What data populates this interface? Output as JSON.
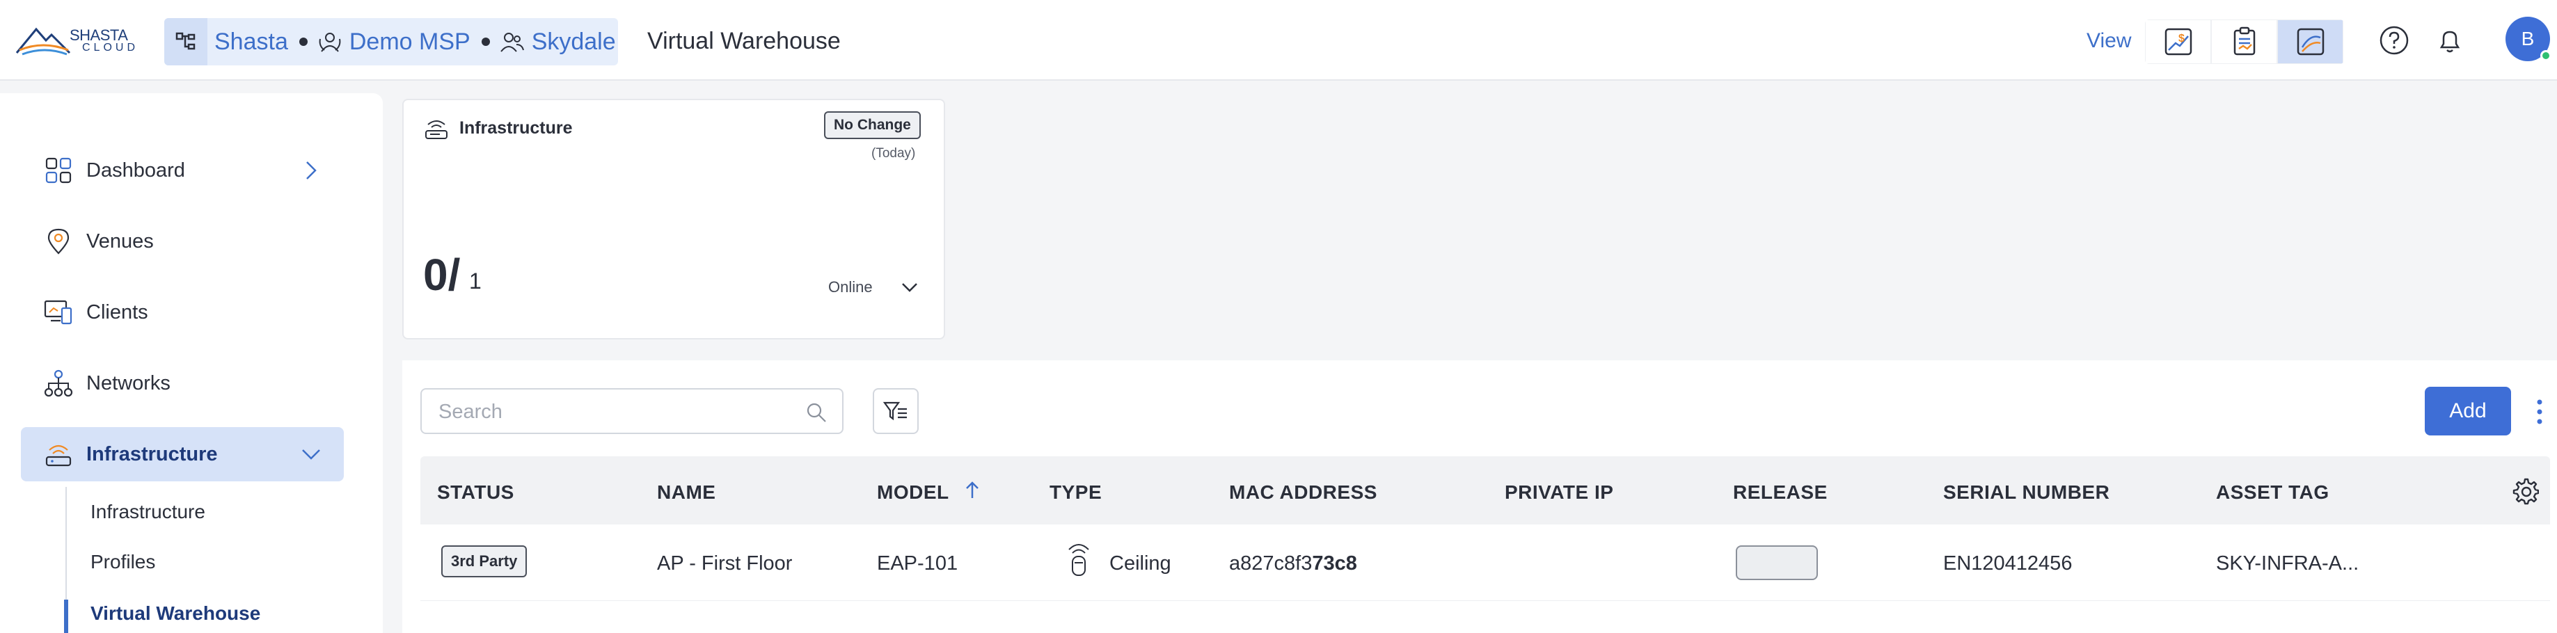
{
  "brand": {
    "line1": "SHASTA",
    "line2": "CLOUD"
  },
  "breadcrumb": [
    {
      "label": "Shasta",
      "icon": "org-chart-icon"
    },
    {
      "label": "Demo MSP",
      "icon": "msp-icon"
    },
    {
      "label": "Skydale",
      "icon": "users-icon"
    }
  ],
  "page_title": "Virtual Warehouse",
  "view": {
    "label": "View",
    "buttons": [
      "billing-view-icon",
      "report-view-icon",
      "network-view-icon"
    ],
    "active_index": 2
  },
  "user": {
    "initial": "B",
    "status_color": "#2fbf71"
  },
  "sidebar": {
    "items": [
      {
        "label": "Dashboard",
        "icon": "dashboard-icon",
        "has_chevron": "right"
      },
      {
        "label": "Venues",
        "icon": "location-pin-icon"
      },
      {
        "label": "Clients",
        "icon": "devices-icon"
      },
      {
        "label": "Networks",
        "icon": "network-tree-icon"
      },
      {
        "label": "Infrastructure",
        "icon": "access-point-icon",
        "has_chevron": "down",
        "active": true
      }
    ],
    "sub_items": [
      {
        "label": "Infrastructure"
      },
      {
        "label": "Profiles"
      },
      {
        "label": "Virtual Warehouse",
        "active": true
      }
    ]
  },
  "summary_card": {
    "title": "Infrastructure",
    "badge": "No Change",
    "badge_sub": "(Today)",
    "count": "0/",
    "total": "1",
    "status": "Online"
  },
  "toolbar": {
    "search_placeholder": "Search",
    "add_label": "Add"
  },
  "table": {
    "columns": [
      "STATUS",
      "NAME",
      "MODEL",
      "TYPE",
      "MAC ADDRESS",
      "PRIVATE IP",
      "RELEASE",
      "SERIAL NUMBER",
      "ASSET TAG"
    ],
    "sorted_column": "MODEL",
    "sort_direction": "ascending",
    "rows": [
      {
        "status": "3rd Party",
        "name": "AP - First Floor",
        "model": "EAP-101",
        "type": "Ceiling",
        "mac_prefix": "a827c8f3",
        "mac_suffix": "73c8",
        "private_ip": "",
        "release": "",
        "serial_number": "EN120412456",
        "asset_tag": "SKY-INFRA-A..."
      }
    ]
  },
  "colors": {
    "accent": "#3e6ed6",
    "active_nav_bg": "#d6e2f8",
    "breadcrumb_bg": "#e6eefb"
  }
}
